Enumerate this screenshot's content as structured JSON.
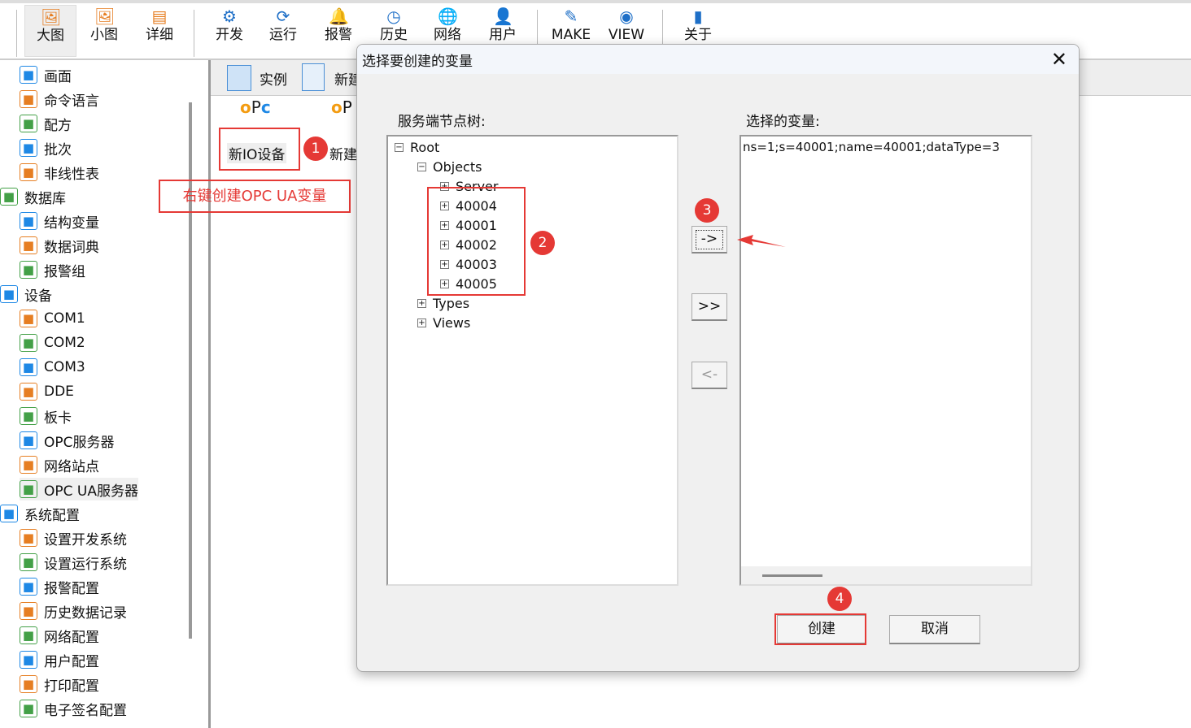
{
  "toolbar": {
    "items": [
      {
        "label": "大图",
        "icon": "large-icon-view"
      },
      {
        "label": "小图",
        "icon": "small-icon-view"
      },
      {
        "label": "详细",
        "icon": "details-view"
      },
      {
        "label": "开发",
        "icon": "develop-gear"
      },
      {
        "label": "运行",
        "icon": "run"
      },
      {
        "label": "报警",
        "icon": "alarm-bell"
      },
      {
        "label": "历史",
        "icon": "history-clock"
      },
      {
        "label": "网络",
        "icon": "network-globe"
      },
      {
        "label": "用户",
        "icon": "user"
      },
      {
        "label": "MAKE",
        "icon": "make-edit"
      },
      {
        "label": "VIEW",
        "icon": "view-eye"
      },
      {
        "label": "关于",
        "icon": "about-book"
      }
    ]
  },
  "sidebar": {
    "items": [
      "画面",
      "命令语言",
      "配方",
      "批次",
      "非线性表",
      "数据库",
      "结构变量",
      "数据词典",
      "报警组",
      "设备",
      "COM1",
      "COM2",
      "COM3",
      "DDE",
      "板卡",
      "OPC服务器",
      "网络站点",
      "OPC UA服务器",
      "系统配置",
      "设置开发系统",
      "设置运行系统",
      "报警配置",
      "历史数据记录",
      "网络配置",
      "用户配置",
      "打印配置",
      "电子签名配置"
    ]
  },
  "pane": {
    "tabs": [
      "实例",
      "新建"
    ],
    "devices": [
      "新IO设备",
      "新建"
    ]
  },
  "annotations": {
    "hint": "右键创建OPC UA变量",
    "badges": [
      "1",
      "2",
      "3",
      "4"
    ],
    "color": "#e53935"
  },
  "dialog": {
    "title": "选择要创建的变量",
    "server_tree_label": "服务端节点树:",
    "selected_label": "选择的变量:",
    "tree": {
      "root": "Root",
      "objects": "Objects",
      "server": "Server",
      "nodes": [
        "40004",
        "40001",
        "40002",
        "40003",
        "40005"
      ],
      "types": "Types",
      "views": "Views"
    },
    "selected": [
      "ns=1;s=40001;name=40001;dataType=3"
    ],
    "buttons": {
      "add": "->",
      "add_all": ">>",
      "remove": "<-",
      "create": "创建",
      "cancel": "取消"
    }
  }
}
